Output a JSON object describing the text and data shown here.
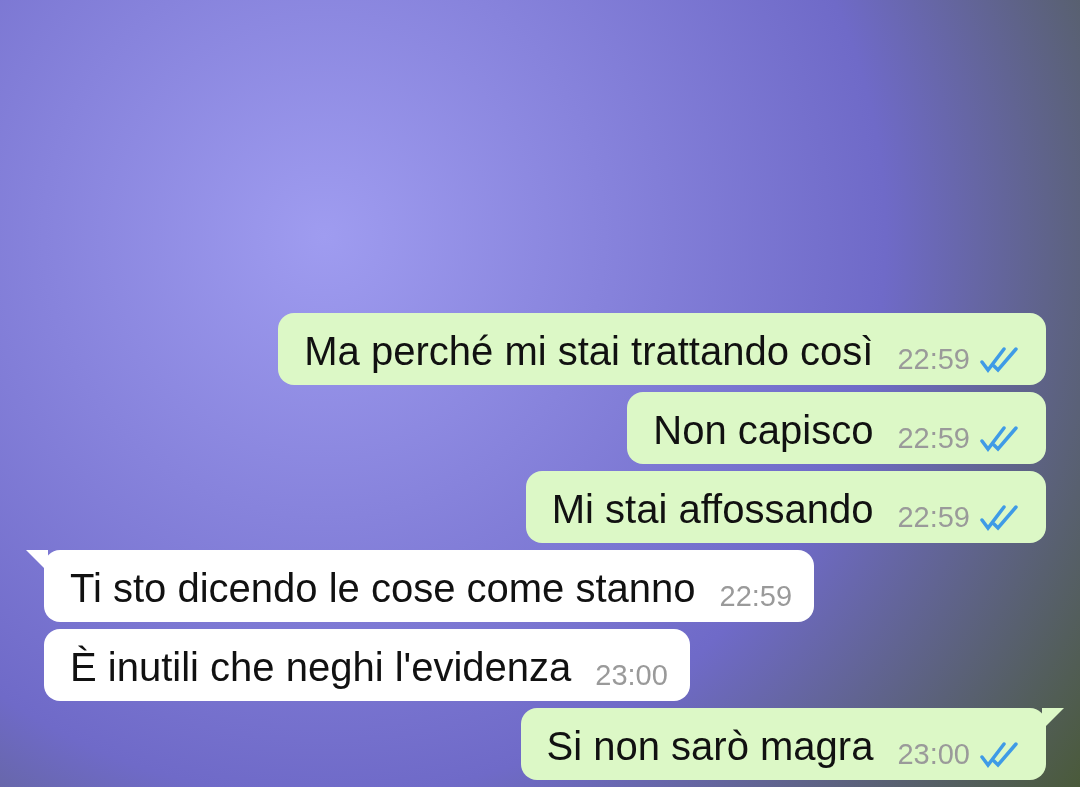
{
  "messages": [
    {
      "kind": "outgoing",
      "text": "Ma perché mi stai trattando così",
      "time": "22:59",
      "read": true
    },
    {
      "kind": "outgoing",
      "text": "Non capisco",
      "time": "22:59",
      "read": true
    },
    {
      "kind": "outgoing",
      "text": "Mi stai affossando",
      "time": "22:59",
      "read": true
    },
    {
      "kind": "incoming",
      "text": "Ti sto dicendo le cose come stanno",
      "time": "22:59"
    },
    {
      "kind": "incoming",
      "text": "È inutili che neghi l'evidenza",
      "time": "23:00"
    },
    {
      "kind": "outgoing",
      "text": "Si non sarò magra",
      "time": "23:00",
      "read": true
    }
  ]
}
